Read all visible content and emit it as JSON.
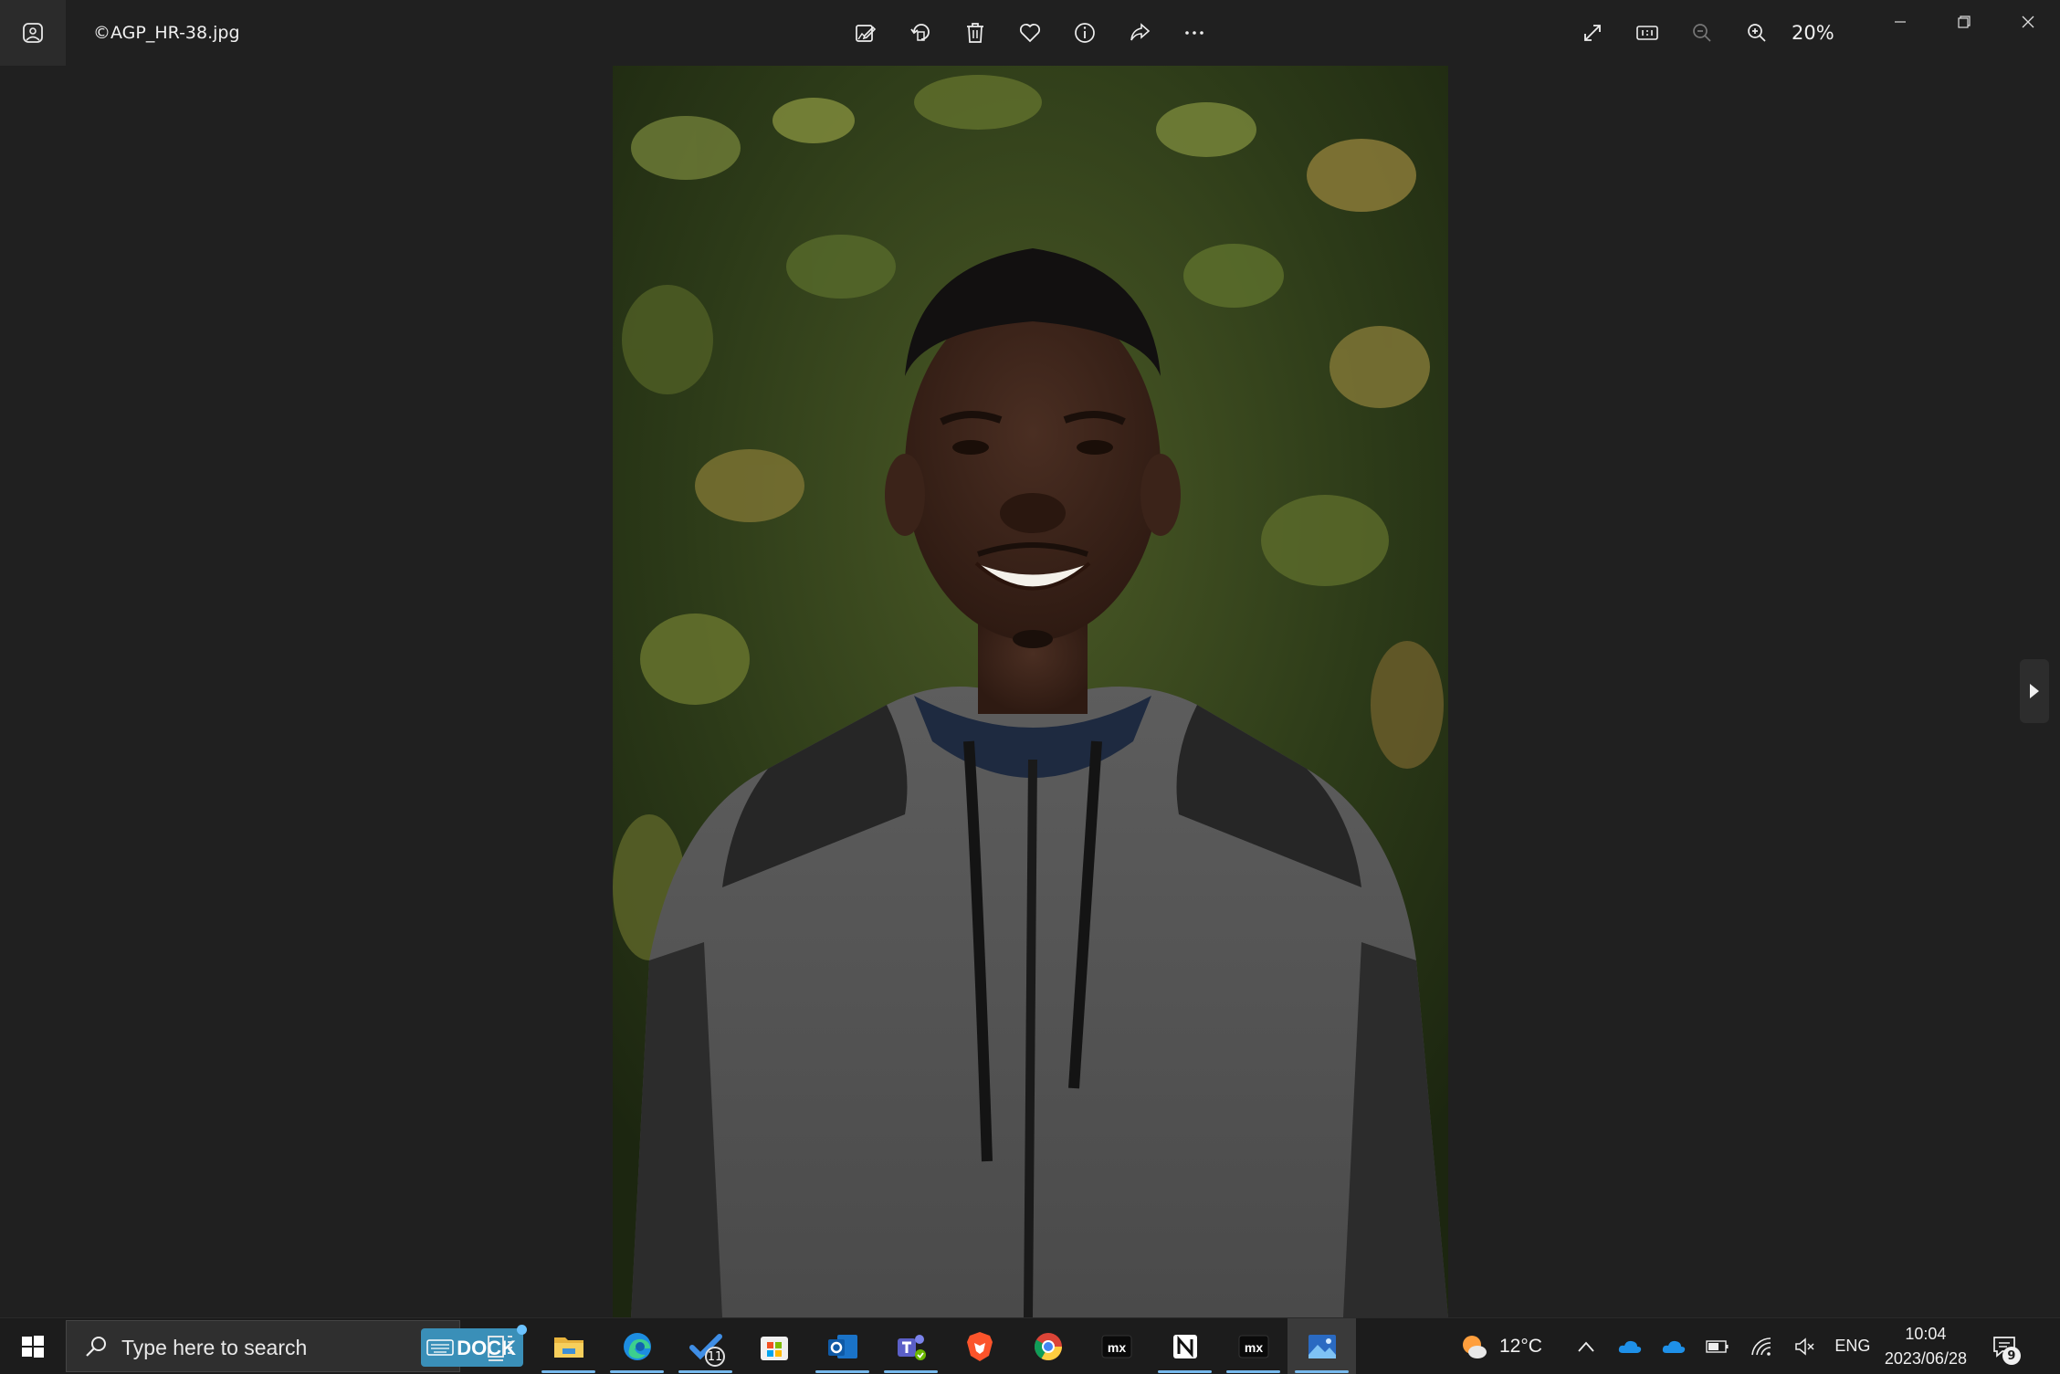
{
  "window": {
    "filename": "©AGP_HR-38.jpg",
    "zoom_level": "20%"
  },
  "toolbar": {
    "left_tools": [
      "edit-image",
      "rotate",
      "delete",
      "favorite",
      "file-info",
      "share",
      "more"
    ],
    "right_tools": [
      "full-screen",
      "actual-size",
      "zoom-out",
      "zoom-in"
    ]
  },
  "image": {
    "subject": "smiling young man in grey hoodie in front of green foliage"
  },
  "taskbar": {
    "search_placeholder": "Type here to search",
    "dock_label": "DOCK",
    "apps": [
      {
        "name": "task-view",
        "running": false
      },
      {
        "name": "file-explorer",
        "running": true
      },
      {
        "name": "edge",
        "running": true
      },
      {
        "name": "todo",
        "running": true,
        "badge": "11"
      },
      {
        "name": "microsoft-store",
        "running": false
      },
      {
        "name": "outlook",
        "running": true
      },
      {
        "name": "teams",
        "running": true
      },
      {
        "name": "brave",
        "running": false
      },
      {
        "name": "chrome",
        "running": false
      },
      {
        "name": "mx",
        "running": false
      },
      {
        "name": "notion",
        "running": true
      },
      {
        "name": "mx",
        "running": true
      },
      {
        "name": "photos",
        "running": true,
        "active": true
      }
    ],
    "todo_badge": "11",
    "weather_temp": "12°C",
    "language": "ENG",
    "time": "10:04",
    "date": "2023/06/28",
    "notification_count": "9"
  },
  "colors": {
    "background": "#202020",
    "taskbar": "#1c1c1c",
    "accent": "#76b9ed",
    "dock": "#3a8fb8"
  }
}
